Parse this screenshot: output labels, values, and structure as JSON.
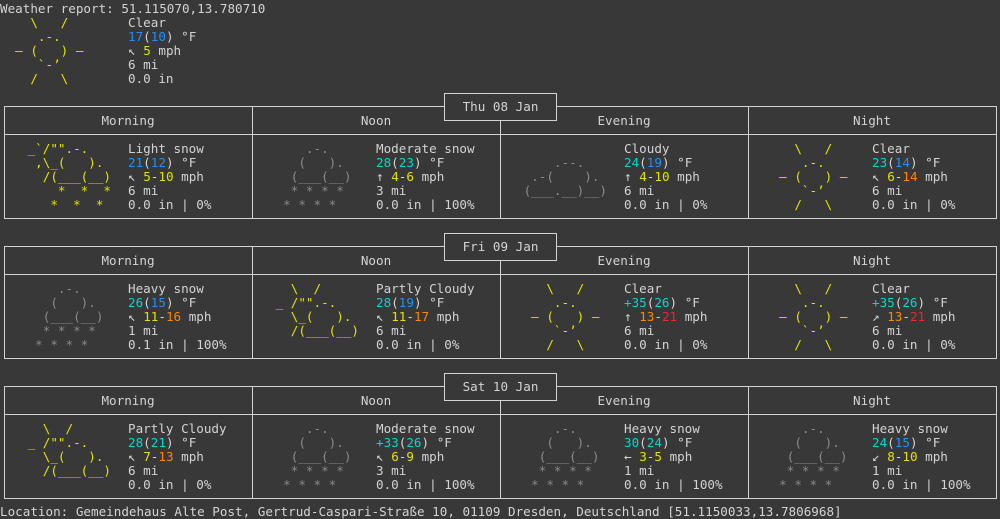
{
  "header": {
    "title": "Weather report: 51.115070,13.780710",
    "current": {
      "art": [
        "    \\   /    ",
        "     .-.     ",
        "  ― (   ) ―  ",
        "     `-’     ",
        "    /   \\    "
      ],
      "art_style": "sun",
      "condition": "Clear",
      "temp": "17",
      "feels": "10",
      "temp_color": "blue",
      "feels_color": "blue",
      "unit": "°F",
      "wind_dir": "↖",
      "wind_low": "5",
      "wind_low_color": "yellow",
      "wind_high": "",
      "wind_high_color": "",
      "wind_unit": "mph",
      "visibility": "6 mi",
      "precip": "0.0 in",
      "chance": ""
    }
  },
  "days": [
    {
      "date": "Thu 08 Jan",
      "periods": [
        {
          "label": "Morning",
          "art": [
            " _`/\"\".-.    ",
            "  ,\\_(   ).  ",
            "   /(___(__) ",
            "     *  *  * ",
            "    *  *  *  "
          ],
          "art_style": "sunsnow",
          "condition": "Light snow",
          "temp": "21",
          "feels": "12",
          "temp_color": "blue",
          "feels_color": "blue",
          "unit": "°F",
          "wind_dir": "↖",
          "wind_low": "5",
          "wind_low_color": "yellow",
          "wind_high": "10",
          "wind_high_color": "yellow",
          "wind_unit": "mph",
          "visibility": "6 mi",
          "precip": "0.0 in",
          "chance": "0%"
        },
        {
          "label": "Noon",
          "art": [
            "     .-.     ",
            "    (   ).   ",
            "   (___(__)  ",
            "   * * * *   ",
            "  * * * *    "
          ],
          "art_style": "snow",
          "condition": "Moderate snow",
          "temp": "28",
          "feels": "23",
          "temp_color": "cyan",
          "feels_color": "cyan",
          "unit": "°F",
          "wind_dir": "↑",
          "wind_low": "4",
          "wind_low_color": "yellow",
          "wind_high": "6",
          "wind_high_color": "yellow",
          "wind_unit": "mph",
          "visibility": "3 mi",
          "precip": "0.0 in",
          "chance": "100%"
        },
        {
          "label": "Evening",
          "art": [
            "             ",
            "     .--.    ",
            "  .-(    ).  ",
            " (___.__)__) ",
            "             "
          ],
          "art_style": "cloud",
          "condition": "Cloudy",
          "temp": "24",
          "feels": "19",
          "temp_color": "cyan",
          "feels_color": "blue",
          "unit": "°F",
          "wind_dir": "↑",
          "wind_low": "4",
          "wind_low_color": "yellow",
          "wind_high": "10",
          "wind_high_color": "yellow",
          "wind_unit": "mph",
          "visibility": "6 mi",
          "precip": "0.0 in",
          "chance": "0%"
        },
        {
          "label": "Night",
          "art": [
            "    \\   /    ",
            "     .-.     ",
            "  ― (   ) ―  ",
            "     `-’     ",
            "    /   \\    "
          ],
          "art_style": "sun",
          "condition": "Clear",
          "temp": "23",
          "feels": "14",
          "temp_color": "cyan",
          "feels_color": "blue",
          "unit": "°F",
          "wind_dir": "↖",
          "wind_low": "6",
          "wind_low_color": "yellow",
          "wind_high": "14",
          "wind_high_color": "orange",
          "wind_unit": "mph",
          "visibility": "6 mi",
          "precip": "0.0 in",
          "chance": "0%"
        }
      ]
    },
    {
      "date": "Fri 09 Jan",
      "periods": [
        {
          "label": "Morning",
          "art": [
            "     .-.     ",
            "    (   ).   ",
            "   (___(__)  ",
            "   * * * *   ",
            "  * * * *    "
          ],
          "art_style": "snow",
          "condition": "Heavy snow",
          "temp": "26",
          "feels": "15",
          "temp_color": "cyan",
          "feels_color": "blue",
          "unit": "°F",
          "wind_dir": "↖",
          "wind_low": "11",
          "wind_low_color": "yellow",
          "wind_high": "16",
          "wind_high_color": "orange",
          "wind_unit": "mph",
          "visibility": "1 mi",
          "precip": "0.1 in",
          "chance": "100%"
        },
        {
          "label": "Noon",
          "art": [
            "   \\  /      ",
            " _ /\"\".-.    ",
            "   \\_(   ).  ",
            "   /(___(__) ",
            "             "
          ],
          "art_style": "partly",
          "condition": "Partly Cloudy",
          "temp": "28",
          "feels": "19",
          "temp_color": "cyan",
          "feels_color": "blue",
          "unit": "°F",
          "wind_dir": "↖",
          "wind_low": "11",
          "wind_low_color": "yellow",
          "wind_high": "17",
          "wind_high_color": "orange",
          "wind_unit": "mph",
          "visibility": "6 mi",
          "precip": "0.0 in",
          "chance": "0%"
        },
        {
          "label": "Evening",
          "art": [
            "    \\   /    ",
            "     .-.     ",
            "  ― (   ) ―  ",
            "     `-’     ",
            "    /   \\    "
          ],
          "art_style": "sun",
          "condition": "Clear",
          "temp": "+35",
          "feels": "26",
          "temp_color": "cyan",
          "feels_color": "cyan",
          "unit": "°F",
          "wind_dir": "↑",
          "wind_low": "13",
          "wind_low_color": "orange",
          "wind_high": "21",
          "wind_high_color": "red",
          "wind_unit": "mph",
          "visibility": "6 mi",
          "precip": "0.0 in",
          "chance": "0%"
        },
        {
          "label": "Night",
          "art": [
            "    \\   /    ",
            "     .-.     ",
            "  ― (   ) ―  ",
            "     `-’     ",
            "    /   \\    "
          ],
          "art_style": "sun",
          "condition": "Clear",
          "temp": "+35",
          "feels": "26",
          "temp_color": "cyan",
          "feels_color": "cyan",
          "unit": "°F",
          "wind_dir": "↗",
          "wind_low": "13",
          "wind_low_color": "orange",
          "wind_high": "21",
          "wind_high_color": "red",
          "wind_unit": "mph",
          "visibility": "6 mi",
          "precip": "0.0 in",
          "chance": "0%"
        }
      ]
    },
    {
      "date": "Sat 10 Jan",
      "periods": [
        {
          "label": "Morning",
          "art": [
            "   \\  /      ",
            " _ /\"\".-.    ",
            "   \\_(   ).  ",
            "   /(___(__) ",
            "             "
          ],
          "art_style": "partly",
          "condition": "Partly Cloudy",
          "temp": "28",
          "feels": "21",
          "temp_color": "cyan",
          "feels_color": "cyan",
          "unit": "°F",
          "wind_dir": "↖",
          "wind_low": "7",
          "wind_low_color": "yellow",
          "wind_high": "13",
          "wind_high_color": "orange",
          "wind_unit": "mph",
          "visibility": "6 mi",
          "precip": "0.0 in",
          "chance": "0%"
        },
        {
          "label": "Noon",
          "art": [
            "     .-.     ",
            "    (   ).   ",
            "   (___(__)  ",
            "   * * * *   ",
            "  * * * *    "
          ],
          "art_style": "snow",
          "condition": "Moderate snow",
          "temp": "+33",
          "feels": "26",
          "temp_color": "cyan",
          "feels_color": "cyan",
          "unit": "°F",
          "wind_dir": "↖",
          "wind_low": "6",
          "wind_low_color": "yellow",
          "wind_high": "9",
          "wind_high_color": "yellow",
          "wind_unit": "mph",
          "visibility": "3 mi",
          "precip": "0.0 in",
          "chance": "100%"
        },
        {
          "label": "Evening",
          "art": [
            "     .-.     ",
            "    (   ).   ",
            "   (___(__)  ",
            "   * * * *   ",
            "  * * * *    "
          ],
          "art_style": "snow",
          "condition": "Heavy snow",
          "temp": "30",
          "feels": "24",
          "temp_color": "cyan",
          "feels_color": "cyan",
          "unit": "°F",
          "wind_dir": "←",
          "wind_low": "3",
          "wind_low_color": "yellow",
          "wind_high": "5",
          "wind_high_color": "yellow",
          "wind_unit": "mph",
          "visibility": "1 mi",
          "precip": "0.0 in",
          "chance": "100%"
        },
        {
          "label": "Night",
          "art": [
            "     .-.     ",
            "    (   ).   ",
            "   (___(__)  ",
            "   * * * *   ",
            "  * * * *    "
          ],
          "art_style": "snow",
          "condition": "Heavy snow",
          "temp": "24",
          "feels": "15",
          "temp_color": "cyan",
          "feels_color": "blue",
          "unit": "°F",
          "wind_dir": "↙",
          "wind_low": "8",
          "wind_low_color": "yellow",
          "wind_high": "10",
          "wind_high_color": "yellow",
          "wind_unit": "mph",
          "visibility": "1 mi",
          "precip": "0.0 in",
          "chance": "100%"
        }
      ]
    }
  ],
  "footer": {
    "location": "Location: Gemeindehaus Alte Post, Gertrud-Caspari-Straße 10, 01109 Dresden, Deutschland [51.1150033,13.7806968]"
  },
  "colors": {
    "background": "#383838",
    "text": "#d3d3d3",
    "blue": "#1e90ff",
    "cyan": "#00d7d7",
    "yellow": "#e3e300",
    "orange": "#ff8700",
    "red": "#ff2020",
    "cloud_gray": "#8a8a8a"
  }
}
